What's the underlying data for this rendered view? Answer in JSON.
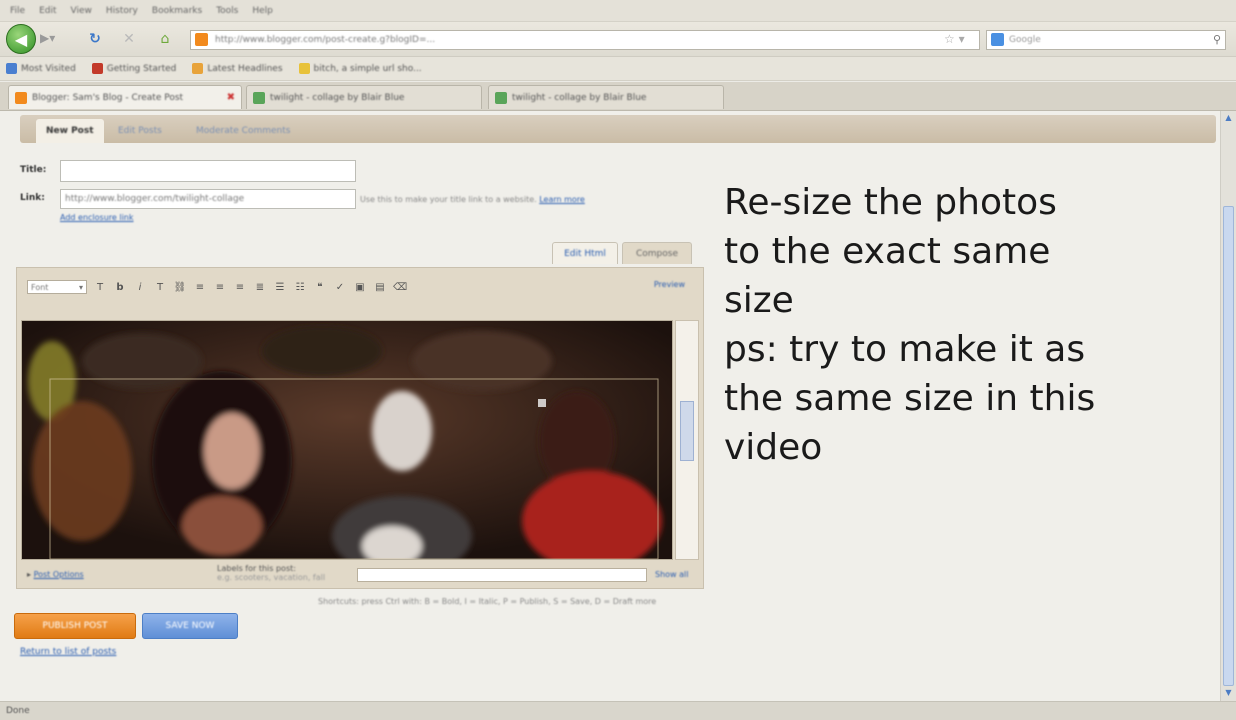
{
  "browser": {
    "menu": [
      "File",
      "Edit",
      "View",
      "History",
      "Bookmarks",
      "Tools",
      "Help"
    ],
    "url": "http://www.blogger.com/post-create.g?blogID=...",
    "search_placeholder": "Google",
    "bookmarks": [
      {
        "label": "Most Visited",
        "color": "#4a7fd0"
      },
      {
        "label": "Getting Started",
        "color": "#c33a2a"
      },
      {
        "label": "Latest Headlines",
        "color": "#e8a33a"
      },
      {
        "label": "bitch, a simple url sho...",
        "color": "#e8c23a"
      }
    ],
    "tabs": [
      {
        "label": "Blogger: Sam's Blog - Create Post",
        "active": true,
        "color": "#f28a1d"
      },
      {
        "label": "twilight - collage by Blair Blue",
        "active": false,
        "color": "#5aa55a"
      },
      {
        "label": "twilight - collage by Blair Blue",
        "active": false,
        "color": "#5aa55a"
      }
    ],
    "status": "Done"
  },
  "blogger": {
    "tabs": [
      "New Post",
      "Edit Posts",
      "Moderate Comments"
    ],
    "title_label": "Title:",
    "title_value": "",
    "link_label": "Link:",
    "link_value": "http://www.blogger.com/twilight-collage",
    "link_help": "Use this to make your title link to a website.",
    "link_help_more": "Learn more",
    "enclosure_link": "Add enclosure link",
    "mode_tabs": [
      "Edit Html",
      "Compose"
    ],
    "font_select": "Font",
    "preview_label": "Preview",
    "toolbar_icons": [
      "font-size-icon",
      "bold-icon",
      "italic-icon",
      "text-color-icon",
      "link-icon",
      "align-left-icon",
      "align-center-icon",
      "align-right-icon",
      "justify-icon",
      "numbered-list-icon",
      "bulleted-list-icon",
      "quote-icon",
      "spellcheck-icon",
      "image-icon",
      "video-icon",
      "remove-formatting-icon"
    ],
    "post_options": "Post Options",
    "labels_caption": "Labels for this post:",
    "labels_example": "e.g. scooters, vacation, fall",
    "show_all": "Show all",
    "shortcuts": "Shortcuts: press Ctrl with: B = Bold, I = Italic, P = Publish, S = Save, D = Draft more",
    "publish_label": "PUBLISH POST",
    "save_label": "SAVE NOW",
    "return_link": "Return to list of posts"
  },
  "overlay": {
    "lines": [
      "Re-size the photos",
      "to the exact same",
      "size",
      "ps: try to make it as",
      "the same size in this",
      "video"
    ]
  }
}
